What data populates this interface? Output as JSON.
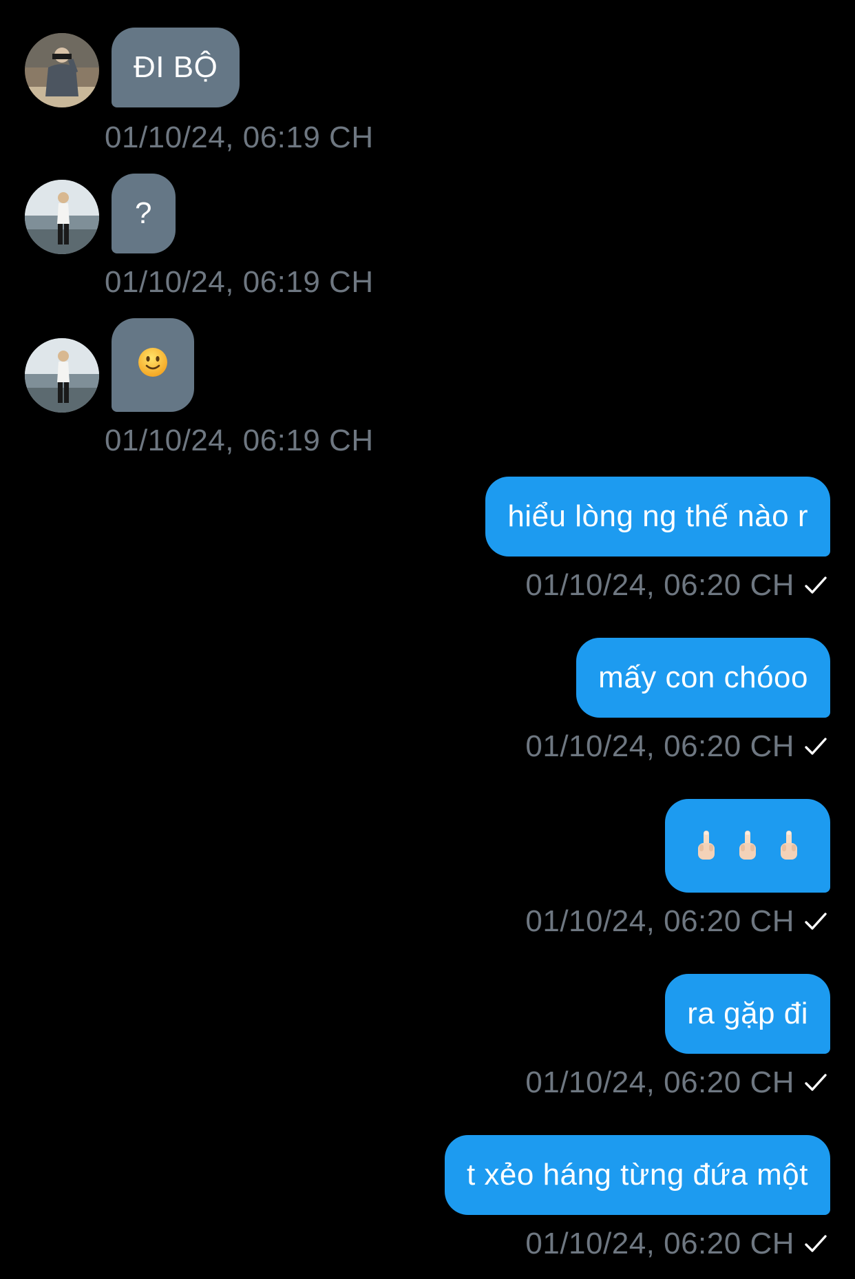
{
  "messages": [
    {
      "side": "in",
      "text": "ĐI BỘ",
      "timestamp": "01/10/24, 06:19 CH",
      "avatar": "avatar-user-a"
    },
    {
      "side": "in",
      "text": "?",
      "timestamp": "01/10/24, 06:19 CH",
      "avatar": "avatar-user-b"
    },
    {
      "side": "in",
      "text": "🙂",
      "timestamp": "01/10/24, 06:19 CH",
      "avatar": "avatar-user-b",
      "icon": "slightly-smiling-face-emoji"
    },
    {
      "side": "out",
      "text": "hiểu lòng ng thế nào r",
      "timestamp": "01/10/24, 06:20 CH",
      "status_icon": "check-icon"
    },
    {
      "side": "out",
      "text": "mấy con chóoo",
      "timestamp": "01/10/24, 06:20 CH",
      "status_icon": "check-icon"
    },
    {
      "side": "out",
      "text": "🖕🏻🖕🏻🖕🏻",
      "timestamp": "01/10/24, 06:20 CH",
      "status_icon": "check-icon",
      "icon": "middle-finger-emoji"
    },
    {
      "side": "out",
      "text": "ra gặp đi",
      "timestamp": "01/10/24, 06:20 CH",
      "status_icon": "check-icon"
    },
    {
      "side": "out",
      "text": "t xẻo háng từng đứa một",
      "timestamp": "01/10/24, 06:20 CH",
      "status_icon": "check-icon"
    }
  ],
  "colors": {
    "background": "#000000",
    "incoming_bubble": "#657786",
    "outgoing_bubble": "#1d9bf0",
    "timestamp": "#6e7781",
    "text": "#ffffff"
  }
}
